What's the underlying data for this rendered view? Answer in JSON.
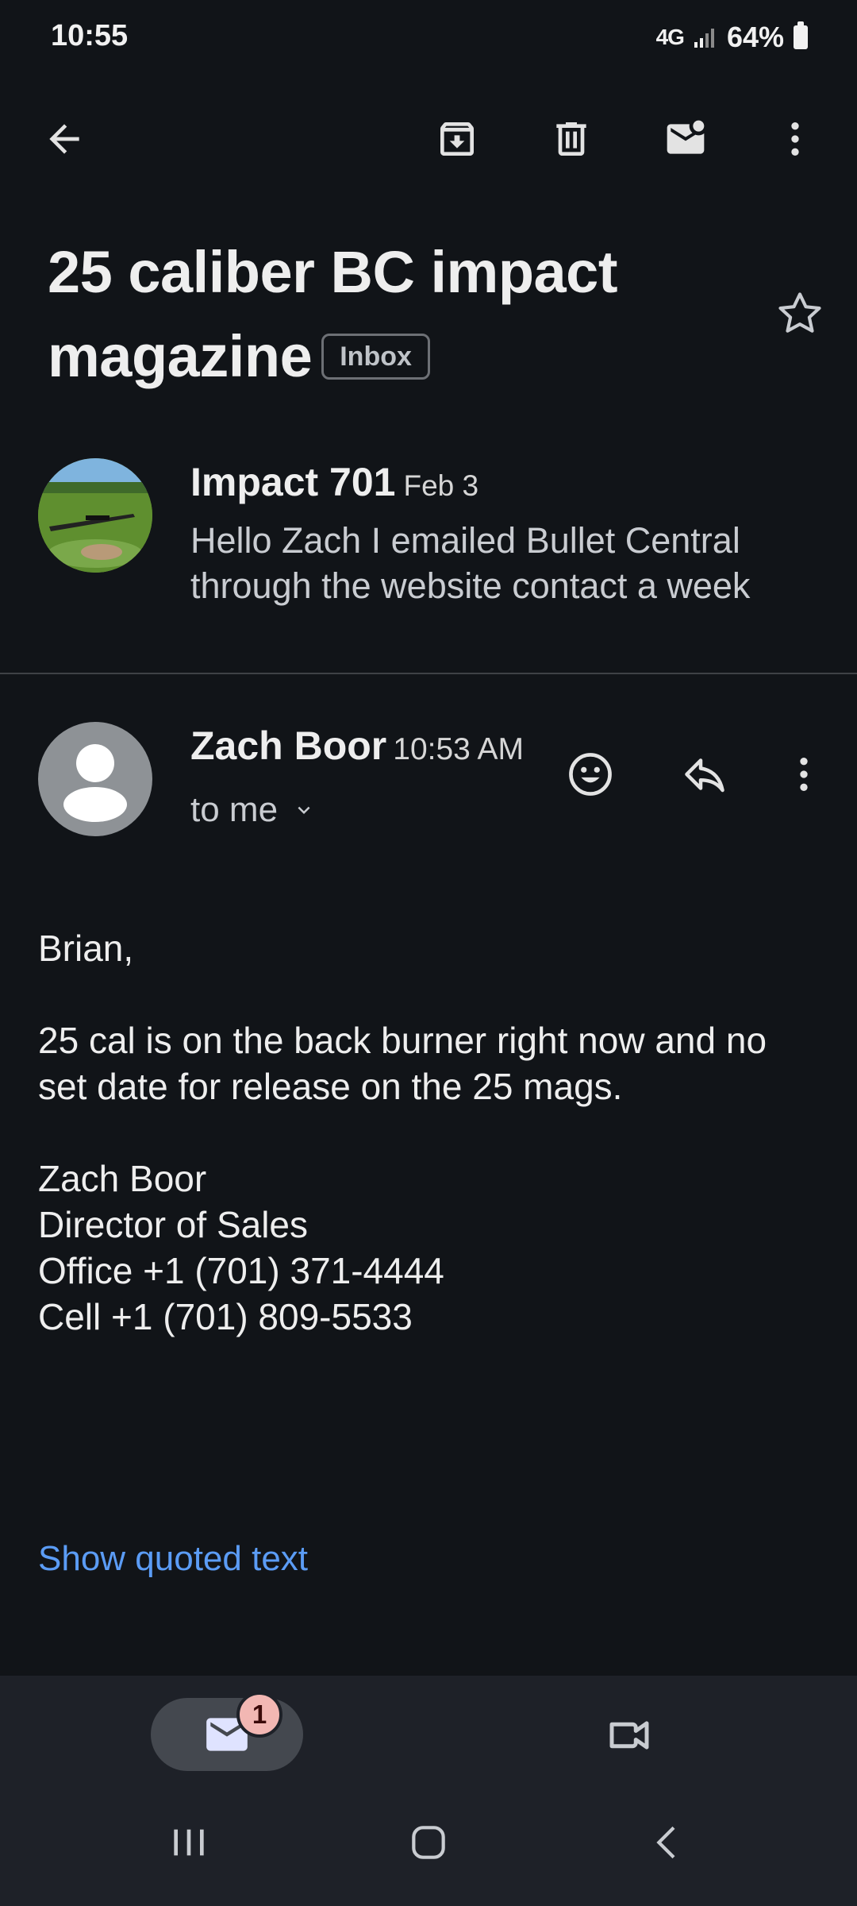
{
  "status_bar": {
    "time": "10:55",
    "network": "4G",
    "battery": "64%"
  },
  "toolbar": {
    "back": "back-arrow-icon",
    "archive": "archive-icon",
    "delete": "trash-icon",
    "mark_unread": "mark-unread-icon",
    "more": "more-vert-icon"
  },
  "thread": {
    "subject": "25 caliber BC impact magazine",
    "label": "Inbox"
  },
  "collapsed_message": {
    "sender": "Impact 701",
    "date": "Feb 3",
    "snippet": "Hello Zach I emailed Bullet Central through the website contact a week"
  },
  "open_message": {
    "sender": "Zach Boor",
    "time": "10:53 AM",
    "recipient": "to me",
    "body": {
      "greeting": "Brian,",
      "paragraph": "25 cal is on the back burner right now and no set date for release on the 25 mags.",
      "signature": [
        "Zach Boor",
        "Director of Sales",
        "Office +1 (701) 371-4444",
        "Cell +1 (701) 809-5533"
      ]
    },
    "show_quoted": "Show quoted text"
  },
  "bottom_nav": {
    "mail_badge": "1"
  },
  "colors": {
    "background": "#111418",
    "link": "#5b9cf5",
    "nav_bg": "#1e2128",
    "badge": "#f2b7b3"
  }
}
